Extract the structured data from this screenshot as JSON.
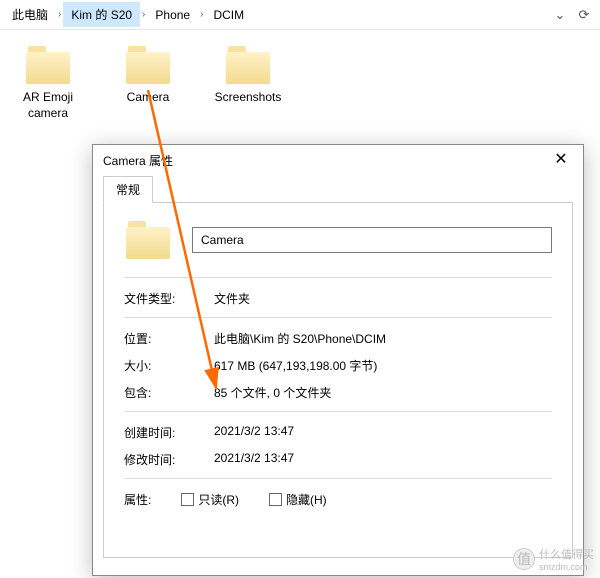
{
  "breadcrumb": {
    "items": [
      "此电脑",
      "Kim 的 S20",
      "Phone",
      "DCIM"
    ],
    "selected_index": 1
  },
  "folders": [
    {
      "label": "AR Emoji camera"
    },
    {
      "label": "Camera"
    },
    {
      "label": "Screenshots"
    }
  ],
  "dialog": {
    "title": "Camera 属性",
    "tab": "常规",
    "name": "Camera",
    "rows": {
      "type_k": "文件类型:",
      "type_v": "文件夹",
      "loc_k": "位置:",
      "loc_v": "此电脑\\Kim 的 S20\\Phone\\DCIM",
      "size_k": "大小:",
      "size_v": "617 MB (647,193,198.00 字节)",
      "cont_k": "包含:",
      "cont_v": "85 个文件, 0 个文件夹",
      "ctime_k": "创建时间:",
      "ctime_v": "2021/3/2 13:47",
      "mtime_k": "修改时间:",
      "mtime_v": "2021/3/2 13:47",
      "attr_k": "属性:"
    },
    "readonly": "只读(R)",
    "hidden": "隐藏(H)"
  },
  "watermark": {
    "text": "什么值得买",
    "site": "smzdm.com",
    "emoji": "值"
  }
}
